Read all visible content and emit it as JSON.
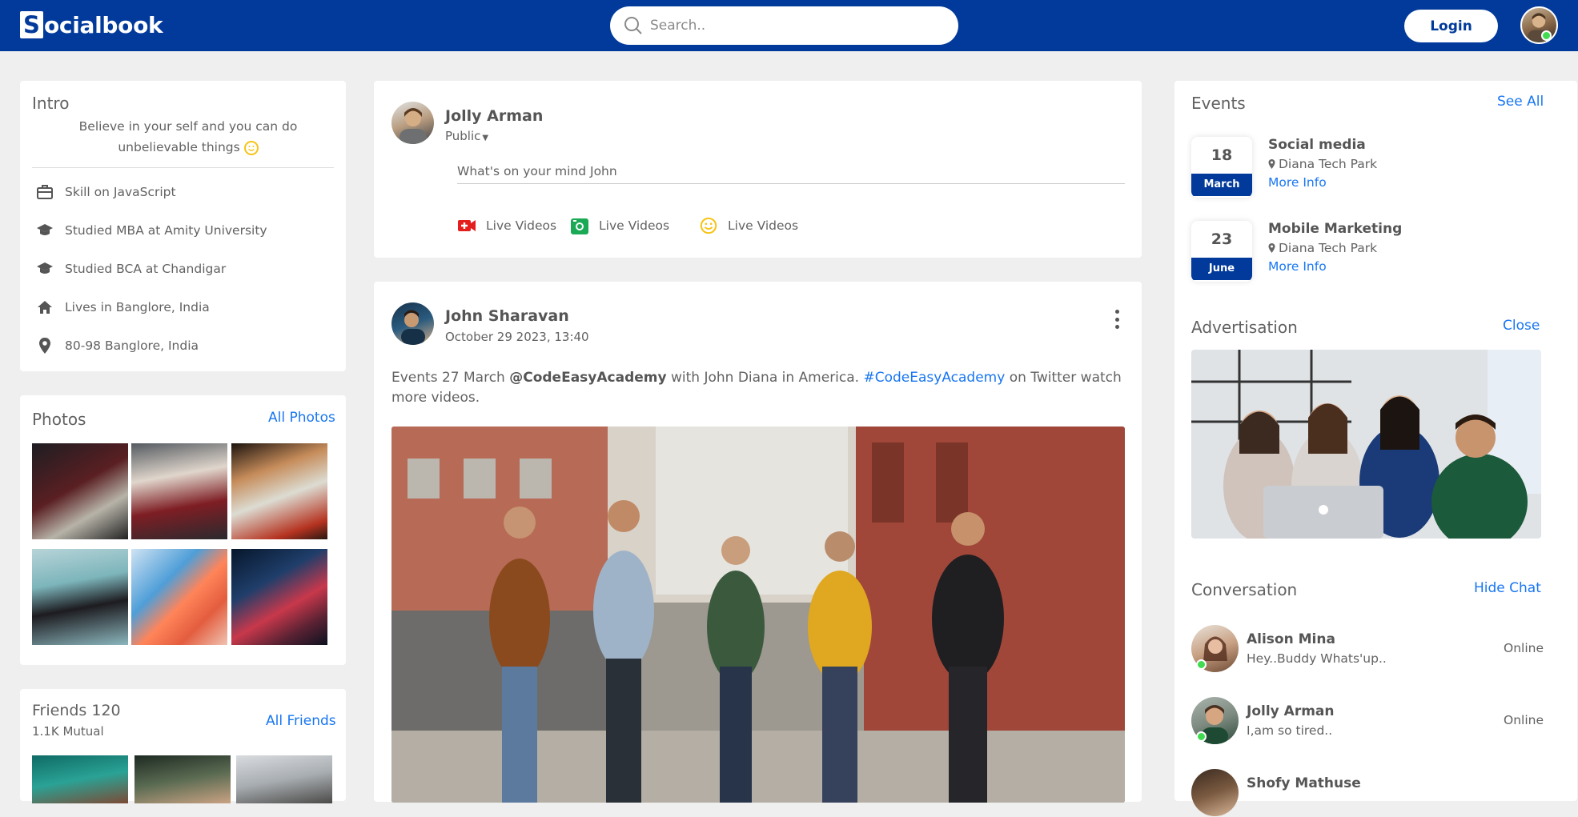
{
  "header": {
    "logo_letter": "S",
    "logo_text": "ocialbook",
    "search_placeholder": "Search..",
    "login_label": "Login",
    "colors": {
      "brand": "#013a9b",
      "link": "#1876f2",
      "online": "#41db51"
    }
  },
  "intro": {
    "title": "Intro",
    "bio": "Believe in your self and you can do unbelievable things",
    "items": [
      {
        "icon": "briefcase-icon",
        "text": "Skill on JavaScript"
      },
      {
        "icon": "graduation-cap-icon",
        "text": "Studied MBA at Amity University"
      },
      {
        "icon": "graduation-cap-icon",
        "text": "Studied BCA at Chandigar"
      },
      {
        "icon": "home-icon",
        "text": "Lives in Banglore, India"
      },
      {
        "icon": "location-pin-icon",
        "text": "80-98 Banglore, India"
      }
    ]
  },
  "photos": {
    "title": "Photos",
    "link": "All Photos"
  },
  "friends": {
    "title": "Friends 120",
    "subtitle": "1.1K Mutual",
    "link": "All Friends"
  },
  "composer": {
    "name": "Jolly Arman",
    "privacy": "Public",
    "placeholder": "What's on your mind John",
    "actions": [
      {
        "icon": "live-video-icon",
        "label": "Live Videos"
      },
      {
        "icon": "camera-icon",
        "label": "Live Videos"
      },
      {
        "icon": "smiley-icon",
        "label": "Live Videos"
      }
    ]
  },
  "post": {
    "name": "John Sharavan",
    "date": "October 29 2023, 13:40",
    "text_1": "Events 27 March ",
    "mention": "@CodeEasyAcademy",
    "text_2": " with John Diana in America. ",
    "hashtag": "#CodeEasyAcademy",
    "text_3": " on Twitter watch more videos."
  },
  "events": {
    "title": "Events",
    "link": "See All",
    "items": [
      {
        "day": "18",
        "month": "March",
        "title": "Social media",
        "location": "Diana Tech Park",
        "more": "More Info"
      },
      {
        "day": "23",
        "month": "June",
        "title": "Mobile Marketing",
        "location": "Diana Tech Park",
        "more": "More Info"
      }
    ]
  },
  "advertisation": {
    "title": "Advertisation",
    "link": "Close"
  },
  "conversation": {
    "title": "Conversation",
    "link": "Hide Chat",
    "chats": [
      {
        "name": "Alison Mina",
        "message": "Hey..Buddy Whats'up..",
        "status": "Online"
      },
      {
        "name": "Jolly Arman",
        "message": "I,am so tired..",
        "status": "Online"
      },
      {
        "name": "Shofy Mathuse",
        "message": "",
        "status": ""
      }
    ]
  }
}
